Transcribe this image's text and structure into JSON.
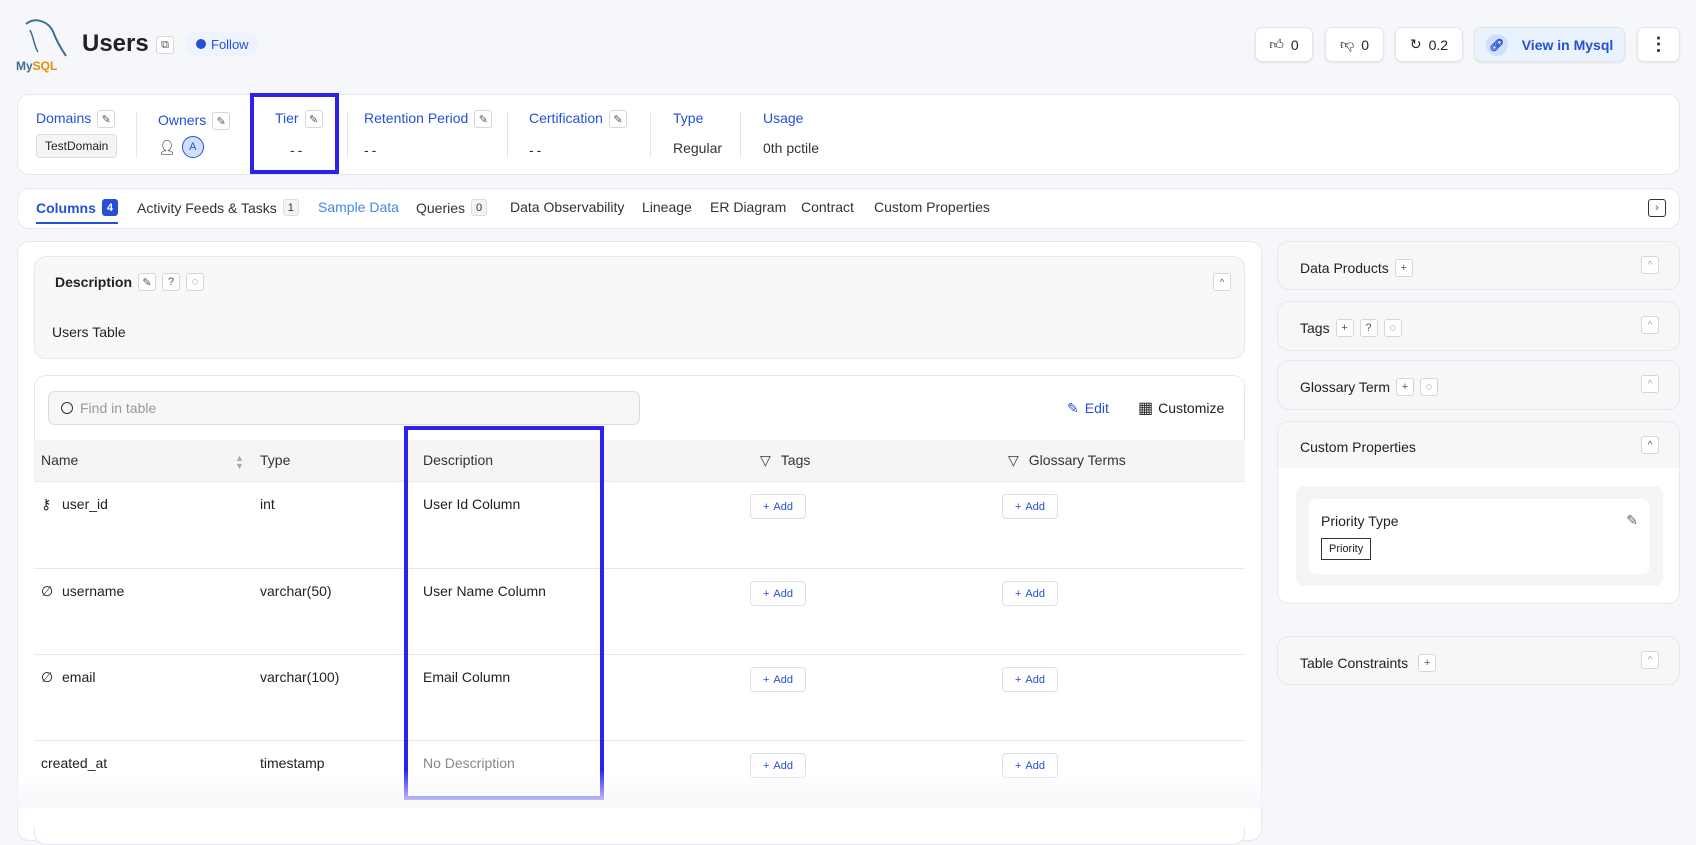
{
  "header": {
    "logo_text": "MySQL",
    "title": "Users",
    "follow_label": "Follow",
    "upvotes": "0",
    "downvotes": "0",
    "version": "0.2",
    "view_label": "View in Mysql"
  },
  "info": {
    "domains_label": "Domains",
    "domain_value": "TestDomain",
    "owners_label": "Owners",
    "owner_avatar": "A",
    "tier_label": "Tier",
    "tier_value": "--",
    "retention_label": "Retention Period",
    "retention_value": "--",
    "certification_label": "Certification",
    "certification_value": "--",
    "type_label": "Type",
    "type_value": "Regular",
    "usage_label": "Usage",
    "usage_value": "0th pctile"
  },
  "tabs": [
    {
      "label": "Columns",
      "count": "4"
    },
    {
      "label": "Activity Feeds & Tasks",
      "count": "1"
    },
    {
      "label": "Sample Data"
    },
    {
      "label": "Queries",
      "count": "0"
    },
    {
      "label": "Data Observability"
    },
    {
      "label": "Lineage"
    },
    {
      "label": "ER Diagram"
    },
    {
      "label": "Contract"
    },
    {
      "label": "Custom Properties"
    }
  ],
  "description": {
    "title": "Description",
    "text": "Users Table"
  },
  "table": {
    "search_placeholder": "Find in table",
    "edit_label": "Edit",
    "customize_label": "Customize",
    "headers": {
      "name": "Name",
      "type": "Type",
      "description": "Description",
      "tags": "Tags",
      "glossary": "Glossary Terms"
    },
    "add_label": "Add",
    "rows": [
      {
        "name": "user_id",
        "type": "int",
        "description": "User Id Column"
      },
      {
        "name": "username",
        "type": "varchar(50)",
        "description": "User Name Column"
      },
      {
        "name": "email",
        "type": "varchar(100)",
        "description": "Email Column"
      },
      {
        "name": "created_at",
        "type": "timestamp",
        "description": "No Description"
      }
    ]
  },
  "right": {
    "data_products": "Data Products",
    "tags": "Tags",
    "glossary": "Glossary Term",
    "custom_properties": "Custom Properties",
    "property_name": "Priority Type",
    "property_value": "Priority",
    "table_constraints": "Table Constraints"
  }
}
